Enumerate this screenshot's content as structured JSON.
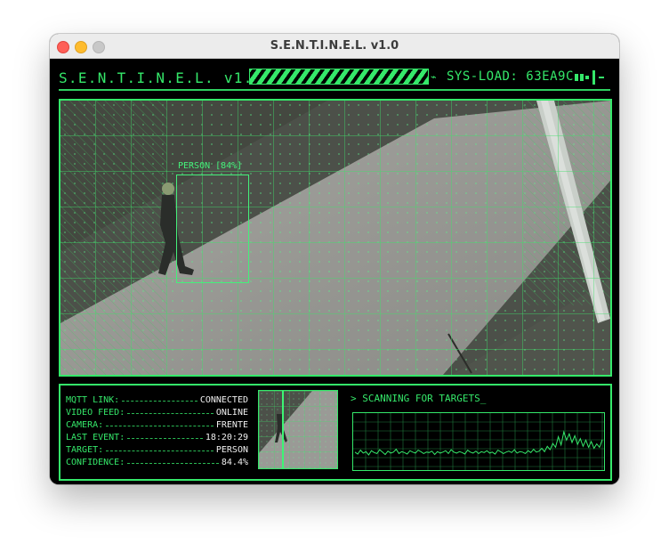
{
  "window": {
    "title": "S.E.N.T.I.N.E.L. v1.0"
  },
  "header": {
    "title": "S.E.N.T.I.N.E.L. v1.0",
    "glyph": "⌁",
    "sys_load_label": "SYS-LOAD:",
    "sys_load_value": "63EA9C"
  },
  "detection": {
    "label": "PERSON [84%]"
  },
  "status": {
    "rows": [
      {
        "key": "MQTT LINK:",
        "value": "CONNECTED"
      },
      {
        "key": "VIDEO FEED:",
        "value": "ONLINE"
      },
      {
        "key": "CAMERA:",
        "value": "FRENTE"
      },
      {
        "key": "LAST EVENT:",
        "value": "18:20:29"
      },
      {
        "key": "TARGET:",
        "value": "PERSON"
      },
      {
        "key": "CONFIDENCE:",
        "value": "84.4%"
      }
    ]
  },
  "scan": {
    "text": "> SCANNING FOR TARGETS_"
  },
  "waveform": {
    "values": [
      0.3,
      0.26,
      0.34,
      0.28,
      0.31,
      0.24,
      0.33,
      0.29,
      0.27,
      0.35,
      0.3,
      0.25,
      0.32,
      0.28,
      0.3,
      0.36,
      0.27,
      0.31,
      0.29,
      0.26,
      0.33,
      0.3,
      0.28,
      0.34,
      0.31,
      0.27,
      0.3,
      0.29,
      0.32,
      0.25,
      0.31,
      0.28,
      0.3,
      0.33,
      0.27,
      0.35,
      0.3,
      0.28,
      0.31,
      0.29,
      0.26,
      0.34,
      0.3,
      0.28,
      0.32,
      0.27,
      0.31,
      0.29,
      0.33,
      0.28,
      0.3,
      0.26,
      0.34,
      0.31,
      0.27,
      0.3,
      0.32,
      0.29,
      0.35,
      0.28,
      0.31,
      0.3,
      0.27,
      0.33,
      0.29,
      0.36,
      0.3,
      0.32,
      0.38,
      0.31,
      0.42,
      0.35,
      0.48,
      0.4,
      0.62,
      0.45,
      0.72,
      0.55,
      0.68,
      0.5,
      0.64,
      0.46,
      0.58,
      0.42,
      0.55,
      0.4,
      0.52,
      0.38,
      0.47,
      0.4,
      0.56
    ]
  },
  "colors": {
    "accent": "#35e86a",
    "background": "#000000",
    "value_text": "#f0f0f0"
  }
}
